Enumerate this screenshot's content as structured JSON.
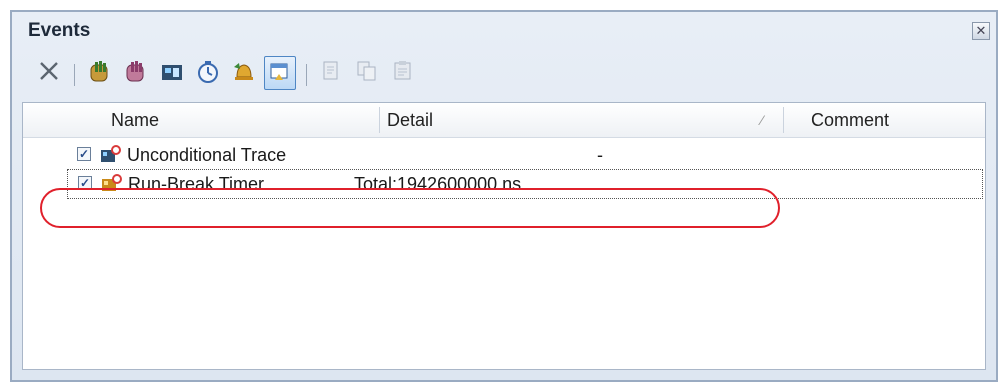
{
  "panel": {
    "title": "Events",
    "close_symbol": "✕"
  },
  "toolbar": {
    "buttons": [
      {
        "icon": "delete-icon"
      },
      {
        "icon": "hardware-break-icon"
      },
      {
        "icon": "software-break-icon"
      },
      {
        "icon": "trace-icon"
      },
      {
        "icon": "timer-icon"
      },
      {
        "icon": "bell-icon"
      },
      {
        "icon": "event-view-icon",
        "active": true
      },
      {
        "icon": "disabled-doc-icon"
      },
      {
        "icon": "disabled-copy-icon"
      },
      {
        "icon": "disabled-paste-icon"
      }
    ]
  },
  "table": {
    "columns": [
      "Name",
      "Detail",
      "Comment"
    ],
    "rows": [
      {
        "checked": true,
        "icon": "trace-event-icon",
        "name": "Unconditional Trace",
        "detail": "-",
        "comment": ""
      },
      {
        "checked": true,
        "icon": "timer-event-icon",
        "name": "Run-Break Timer",
        "detail": "Total:1942600000 ns",
        "comment": ""
      }
    ]
  },
  "colors": {
    "accent": "#4e86c4",
    "highlight": "#e0202b"
  }
}
